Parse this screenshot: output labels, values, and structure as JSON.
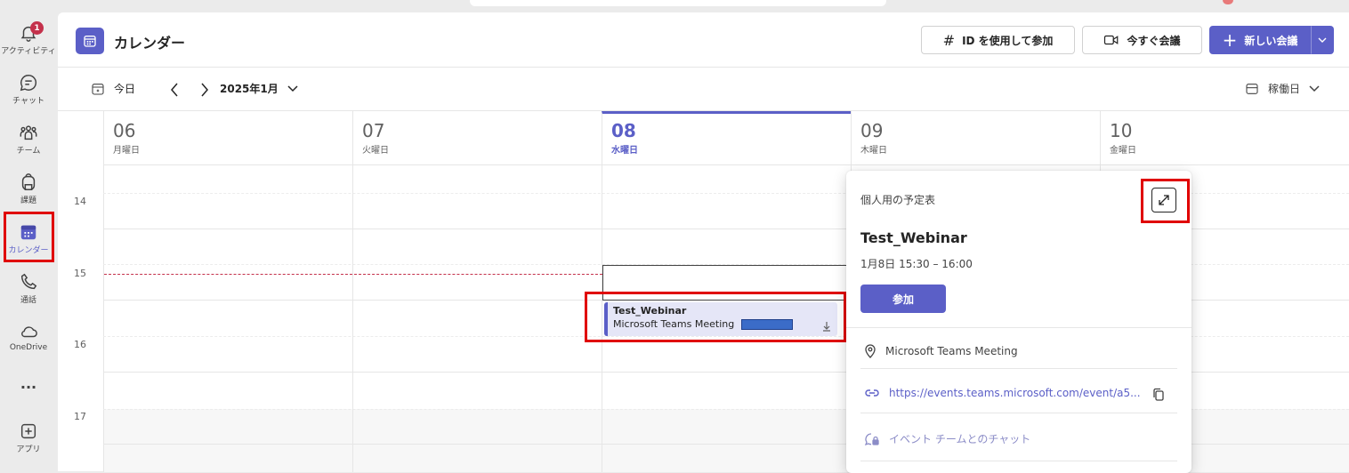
{
  "rail": {
    "items": [
      {
        "label": "アクティビティ",
        "badge": "1"
      },
      {
        "label": "チャット"
      },
      {
        "label": "チーム"
      },
      {
        "label": "課題"
      },
      {
        "label": "カレンダー"
      },
      {
        "label": "通話"
      },
      {
        "label": "OneDrive"
      },
      {
        "label": "..."
      },
      {
        "label": "アプリ"
      }
    ]
  },
  "header": {
    "title": "カレンダー",
    "join_id_label": "ID を使用して参加",
    "meet_now_label": "今すぐ会議",
    "new_meeting_label": "新しい会議"
  },
  "toolbar": {
    "today_label": "今日",
    "month_label": "2025年1月",
    "view_label": "稼働日"
  },
  "days": [
    {
      "num": "06",
      "weekday": "月曜日"
    },
    {
      "num": "07",
      "weekday": "火曜日"
    },
    {
      "num": "08",
      "weekday": "水曜日",
      "today": true
    },
    {
      "num": "09",
      "weekday": "木曜日"
    },
    {
      "num": "10",
      "weekday": "金曜日"
    }
  ],
  "hours": [
    "14",
    "15",
    "16",
    "17"
  ],
  "event": {
    "title": "Test_Webinar",
    "subtitle": "Microsoft Teams Meeting"
  },
  "popup": {
    "calendar_name": "個人用の予定表",
    "title": "Test_Webinar",
    "time": "1月8日 15:30 – 16:00",
    "join_label": "参加",
    "location": "Microsoft Teams Meeting",
    "link": "https://events.teams.microsoft.com/event/a5...",
    "chat_label": "イベント チームとのチャット"
  },
  "colors": {
    "accent": "#5b5fc7",
    "highlight": "#e00000",
    "badge": "#c4314b"
  }
}
